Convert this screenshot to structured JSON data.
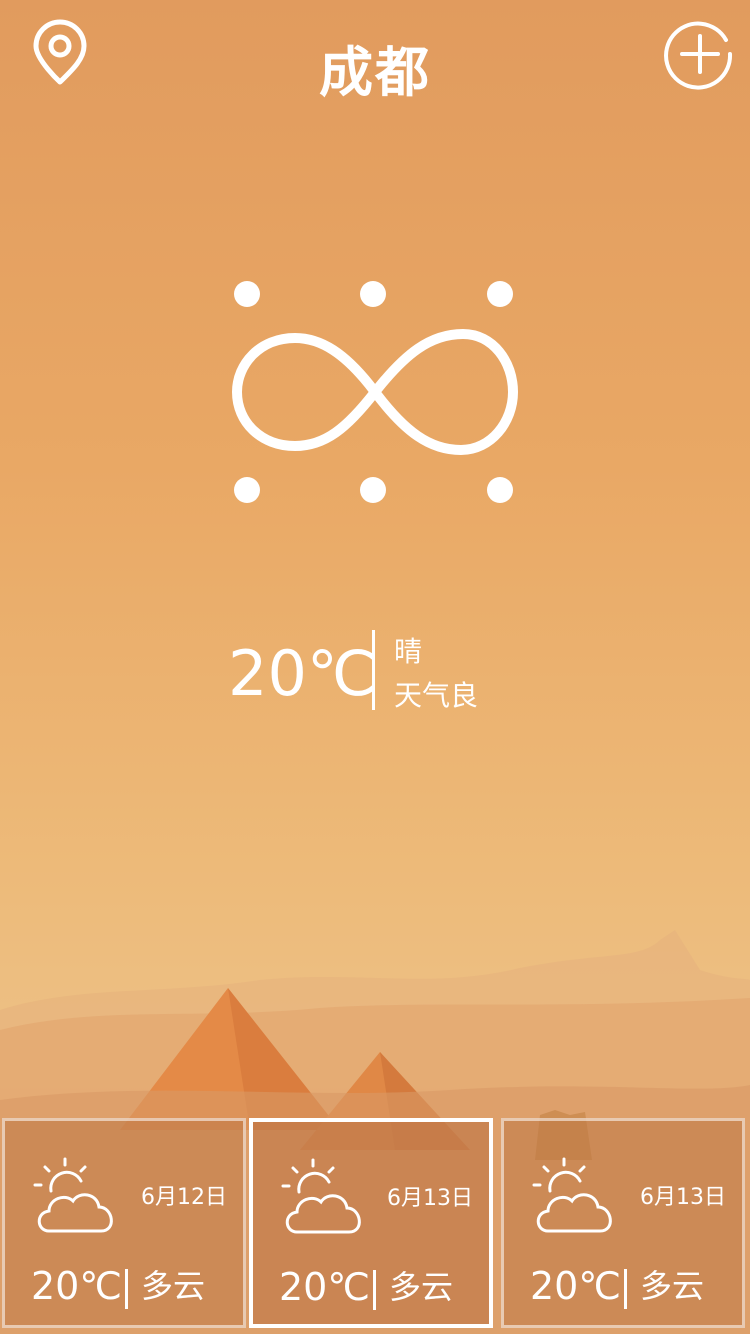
{
  "header": {
    "city": "成都",
    "location_icon": "location-pin-icon",
    "add_icon": "add-circle-icon"
  },
  "current": {
    "temperature": "20℃",
    "condition": "晴",
    "air_quality": "天气良",
    "icon": "wind-infinity-icon"
  },
  "forecast": [
    {
      "date": "6月12日",
      "temperature": "20℃",
      "condition": "多云",
      "icon": "partly-cloudy-icon",
      "selected": false
    },
    {
      "date": "6月13日",
      "temperature": "20℃",
      "condition": "多云",
      "icon": "partly-cloudy-icon",
      "selected": true
    },
    {
      "date": "6月13日",
      "temperature": "20℃",
      "condition": "多云",
      "icon": "partly-cloudy-icon",
      "selected": false
    }
  ],
  "colors": {
    "sky_top": "#E19B5E",
    "sky_bottom": "#EDC084",
    "pyramid": "#E8904A"
  }
}
